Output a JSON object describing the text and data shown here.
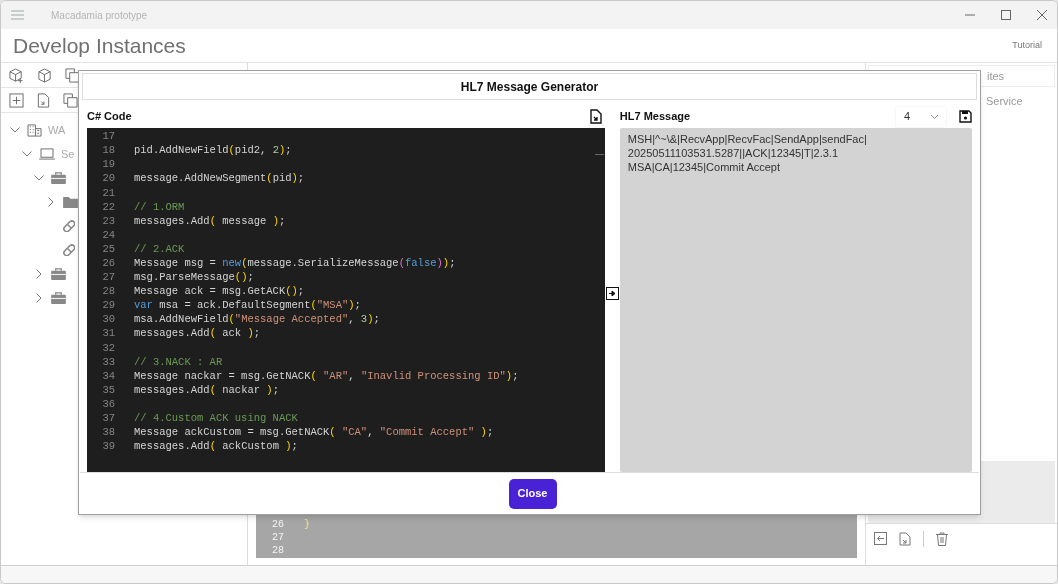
{
  "app": {
    "title": "Macadamia prototype",
    "page_title": "Develop Instances",
    "tutorial_link": "Tutorial"
  },
  "tree": {
    "items": [
      {
        "label": "WA",
        "kind": "building",
        "expanded": true,
        "children": [
          {
            "label": "Se",
            "kind": "computer",
            "expanded": true,
            "children": [
              {
                "kind": "briefcase",
                "expanded": true,
                "children": [
                  {
                    "kind": "folder",
                    "expanded": false
                  },
                  {
                    "kind": "pill"
                  },
                  {
                    "kind": "pill"
                  }
                ]
              },
              {
                "kind": "briefcase",
                "expanded": false
              },
              {
                "kind": "briefcase",
                "expanded": false
              }
            ]
          }
        ]
      }
    ]
  },
  "right_panel": {
    "tab": "ites",
    "item": "Service"
  },
  "background_editor": {
    "lines": [
      {
        "number": "26",
        "code": "}"
      },
      {
        "number": "27"
      },
      {
        "number": "28"
      }
    ]
  },
  "dialog": {
    "title": "HL7 Message Generator",
    "code_panel": {
      "title": "C# Code",
      "lines": [
        {
          "number": "17"
        },
        {
          "number": "18",
          "tokens": [
            {
              "kind": "plain",
              "text": "pid.AddNewField"
            },
            {
              "kind": "paren",
              "text": "("
            },
            {
              "kind": "plain",
              "text": "pid2, "
            },
            {
              "kind": "number",
              "text": "2"
            },
            {
              "kind": "paren",
              "text": ")"
            },
            {
              "kind": "plain",
              "text": ";"
            }
          ]
        },
        {
          "number": "19"
        },
        {
          "number": "20",
          "tokens": [
            {
              "kind": "plain",
              "text": "message.AddNewSegment"
            },
            {
              "kind": "paren",
              "text": "("
            },
            {
              "kind": "plain",
              "text": "pid"
            },
            {
              "kind": "paren",
              "text": ")"
            },
            {
              "kind": "plain",
              "text": ";"
            }
          ]
        },
        {
          "number": "21"
        },
        {
          "number": "22",
          "tokens": [
            {
              "kind": "comment",
              "text": "// 1.ORM"
            }
          ]
        },
        {
          "number": "23",
          "tokens": [
            {
              "kind": "plain",
              "text": "messages.Add"
            },
            {
              "kind": "paren",
              "text": "("
            },
            {
              "kind": "plain",
              "text": " message "
            },
            {
              "kind": "paren",
              "text": ")"
            },
            {
              "kind": "plain",
              "text": ";"
            }
          ]
        },
        {
          "number": "24"
        },
        {
          "number": "25",
          "tokens": [
            {
              "kind": "comment",
              "text": "// 2.ACK"
            }
          ]
        },
        {
          "number": "26",
          "tokens": [
            {
              "kind": "plain",
              "text": "Message msg = "
            },
            {
              "kind": "keyword",
              "text": "new"
            },
            {
              "kind": "paren",
              "text": "("
            },
            {
              "kind": "plain",
              "text": "message.SerializeMessage"
            },
            {
              "kind": "paren2",
              "text": "("
            },
            {
              "kind": "keyword",
              "text": "false"
            },
            {
              "kind": "paren2",
              "text": ")"
            },
            {
              "kind": "paren",
              "text": ")"
            },
            {
              "kind": "plain",
              "text": ";"
            }
          ]
        },
        {
          "number": "27",
          "tokens": [
            {
              "kind": "plain",
              "text": "msg.ParseMessage"
            },
            {
              "kind": "paren",
              "text": "()"
            },
            {
              "kind": "plain",
              "text": ";"
            }
          ]
        },
        {
          "number": "28",
          "tokens": [
            {
              "kind": "plain",
              "text": "Message ack = msg.GetACK"
            },
            {
              "kind": "paren",
              "text": "()"
            },
            {
              "kind": "plain",
              "text": ";"
            }
          ]
        },
        {
          "number": "29",
          "tokens": [
            {
              "kind": "keyword",
              "text": "var"
            },
            {
              "kind": "plain",
              "text": " msa = ack.DefaultSegment"
            },
            {
              "kind": "paren",
              "text": "("
            },
            {
              "kind": "string",
              "text": "\"MSA\""
            },
            {
              "kind": "paren",
              "text": ")"
            },
            {
              "kind": "plain",
              "text": ";"
            }
          ]
        },
        {
          "number": "30",
          "tokens": [
            {
              "kind": "plain",
              "text": "msa.AddNewField"
            },
            {
              "kind": "paren",
              "text": "("
            },
            {
              "kind": "string",
              "text": "\"Message Accepted\""
            },
            {
              "kind": "plain",
              "text": ", "
            },
            {
              "kind": "number",
              "text": "3"
            },
            {
              "kind": "paren",
              "text": ")"
            },
            {
              "kind": "plain",
              "text": ";"
            }
          ]
        },
        {
          "number": "31",
          "tokens": [
            {
              "kind": "plain",
              "text": "messages.Add"
            },
            {
              "kind": "paren",
              "text": "("
            },
            {
              "kind": "plain",
              "text": " ack "
            },
            {
              "kind": "paren",
              "text": ")"
            },
            {
              "kind": "plain",
              "text": ";"
            }
          ]
        },
        {
          "number": "32"
        },
        {
          "number": "33",
          "tokens": [
            {
              "kind": "comment",
              "text": "// 3.NACK : AR"
            }
          ]
        },
        {
          "number": "34",
          "tokens": [
            {
              "kind": "plain",
              "text": "Message nackar = msg.GetNACK"
            },
            {
              "kind": "paren",
              "text": "("
            },
            {
              "kind": "string",
              "text": " \"AR\""
            },
            {
              "kind": "plain",
              "text": ", "
            },
            {
              "kind": "string",
              "text": "\"Inavlid Processing ID\""
            },
            {
              "kind": "paren",
              "text": ")"
            },
            {
              "kind": "plain",
              "text": ";"
            }
          ]
        },
        {
          "number": "35",
          "tokens": [
            {
              "kind": "plain",
              "text": "messages.Add"
            },
            {
              "kind": "paren",
              "text": "("
            },
            {
              "kind": "plain",
              "text": " nackar "
            },
            {
              "kind": "paren",
              "text": ")"
            },
            {
              "kind": "plain",
              "text": ";"
            }
          ]
        },
        {
          "number": "36"
        },
        {
          "number": "37",
          "tokens": [
            {
              "kind": "comment",
              "text": "// 4.Custom ACK using NACK"
            }
          ]
        },
        {
          "number": "38",
          "tokens": [
            {
              "kind": "plain",
              "text": "Message ackCustom = msg.GetNACK"
            },
            {
              "kind": "paren",
              "text": "("
            },
            {
              "kind": "string",
              "text": " \"CA\""
            },
            {
              "kind": "plain",
              "text": ", "
            },
            {
              "kind": "string",
              "text": "\"Commit Accept\" "
            },
            {
              "kind": "paren",
              "text": ")"
            },
            {
              "kind": "plain",
              "text": ";"
            }
          ]
        },
        {
          "number": "39",
          "tokens": [
            {
              "kind": "plain",
              "text": "messages.Add"
            },
            {
              "kind": "paren",
              "text": "("
            },
            {
              "kind": "plain",
              "text": " ackCustom "
            },
            {
              "kind": "paren",
              "text": ")"
            },
            {
              "kind": "plain",
              "text": ";"
            }
          ]
        }
      ]
    },
    "message_panel": {
      "title": "HL7 Message",
      "selector": "4",
      "text_lines": [
        "MSH|^~\\&|RecvApp|RecvFac|SendApp|sendFac|",
        "20250511103531.5287||ACK|12345|T|2.3.1",
        "MSA|CA|12345|Commit Accept"
      ]
    },
    "close_button": "Close"
  }
}
